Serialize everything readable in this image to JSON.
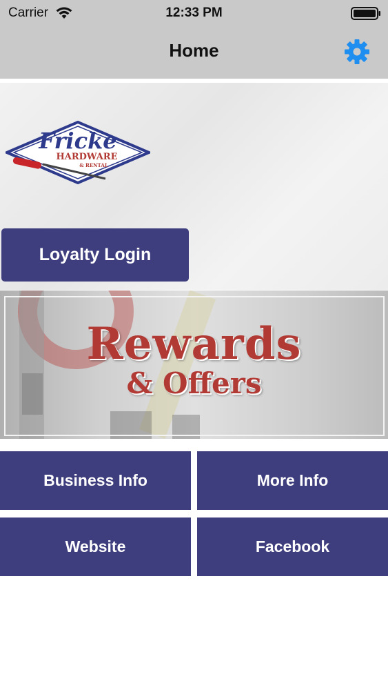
{
  "status_bar": {
    "carrier": "Carrier",
    "time": "12:33 PM"
  },
  "nav": {
    "title": "Home",
    "settings_icon": "gear-icon"
  },
  "logo": {
    "text_main": "Fricke",
    "text_sub": "HARDWARE",
    "text_small": "& RENTAL"
  },
  "loyalty": {
    "label": "Loyalty Login"
  },
  "banner": {
    "title": "Rewards",
    "subtitle": "& Offers"
  },
  "tiles": [
    {
      "label": "Business Info"
    },
    {
      "label": "More Info"
    },
    {
      "label": "Website"
    },
    {
      "label": "Facebook"
    }
  ],
  "colors": {
    "brand_navy": "#3e3d7e",
    "accent_blue": "#1e8ef0",
    "rewards_red": "#b23a34",
    "bar_gray": "#c9c9c9"
  }
}
